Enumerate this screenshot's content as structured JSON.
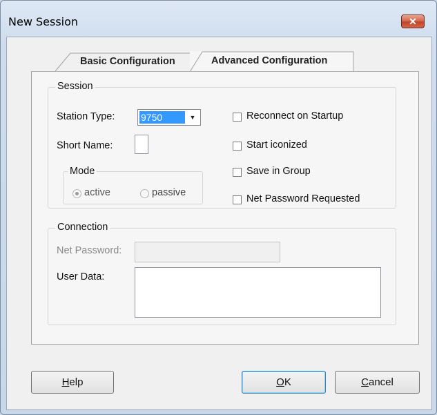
{
  "window": {
    "title": "New Session",
    "close_glyph": "✕"
  },
  "tabs": [
    {
      "label": "Basic Configuration",
      "selected": false
    },
    {
      "label": "Advanced Configuration",
      "selected": true
    }
  ],
  "session": {
    "group_label": "Session",
    "station_type_label": "Station Type:",
    "station_type_value": "9750",
    "short_name_label": "Short Name:",
    "short_name_value": "",
    "mode": {
      "group_label": "Mode",
      "options": [
        {
          "label": "active",
          "selected": true,
          "enabled": false
        },
        {
          "label": "passive",
          "selected": false,
          "enabled": false
        }
      ]
    },
    "checkboxes": [
      {
        "label": "Reconnect on Startup",
        "checked": false
      },
      {
        "label": "Start iconized",
        "checked": false
      },
      {
        "label": "Save in Group",
        "checked": false
      },
      {
        "label": "Net Password Requested",
        "checked": false
      }
    ]
  },
  "connection": {
    "group_label": "Connection",
    "net_password_label": "Net Password:",
    "net_password_value": "",
    "user_data_label": "User Data:",
    "user_data_value": ""
  },
  "buttons": {
    "help": {
      "mnemonic": "H",
      "rest": "elp"
    },
    "ok": {
      "mnemonic": "O",
      "rest": "K"
    },
    "cancel": {
      "mnemonic": "C",
      "rest": "ancel"
    }
  },
  "icons": {
    "close": "close-icon",
    "dropdown": "chevron-down-icon"
  },
  "colors": {
    "selection": "#3399ff",
    "close_button": "#c0452a"
  }
}
